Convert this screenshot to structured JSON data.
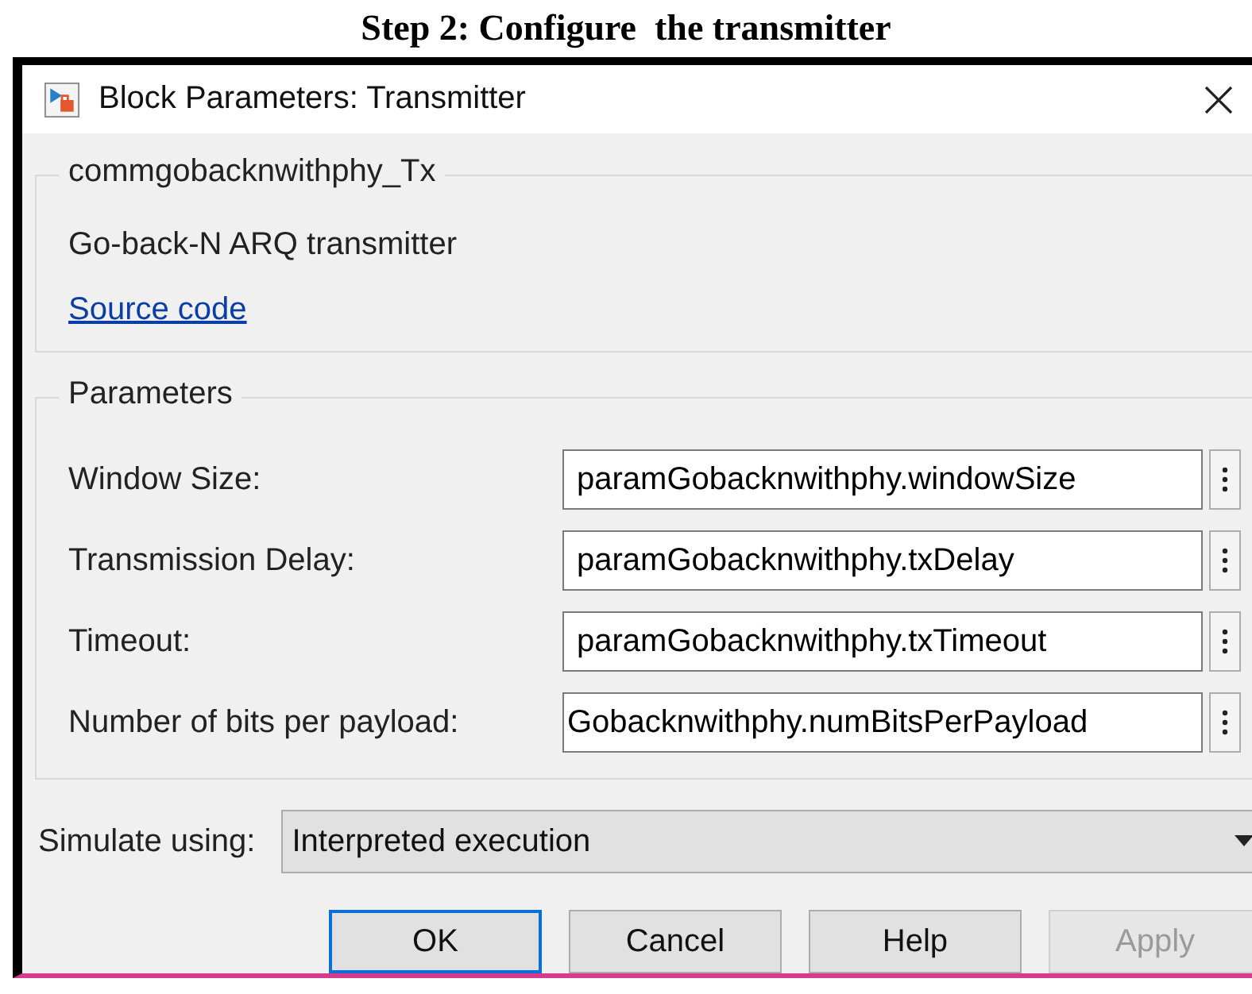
{
  "caption": "Step 2: Configure  the transmitter",
  "window": {
    "title": "Block Parameters: Transmitter"
  },
  "description": {
    "legend": "commgobacknwithphy_Tx",
    "text": "Go-back-N ARQ transmitter",
    "link": "Source code"
  },
  "parameters": {
    "legend": "Parameters",
    "fields": [
      {
        "label": "Window Size:",
        "value": "paramGobacknwithphy.windowSize"
      },
      {
        "label": "Transmission Delay:",
        "value": "paramGobacknwithphy.txDelay"
      },
      {
        "label": "Timeout:",
        "value": "paramGobacknwithphy.txTimeout"
      },
      {
        "label": "Number of bits per payload:",
        "value": "Gobacknwithphy.numBitsPerPayload"
      }
    ]
  },
  "simulate": {
    "label": "Simulate using:",
    "value": "Interpreted execution"
  },
  "buttons": [
    {
      "label": "OK",
      "focused": true,
      "disabled": false
    },
    {
      "label": "Cancel",
      "focused": false,
      "disabled": false
    },
    {
      "label": "Help",
      "focused": false,
      "disabled": false
    },
    {
      "label": "Apply",
      "focused": false,
      "disabled": true
    }
  ]
}
